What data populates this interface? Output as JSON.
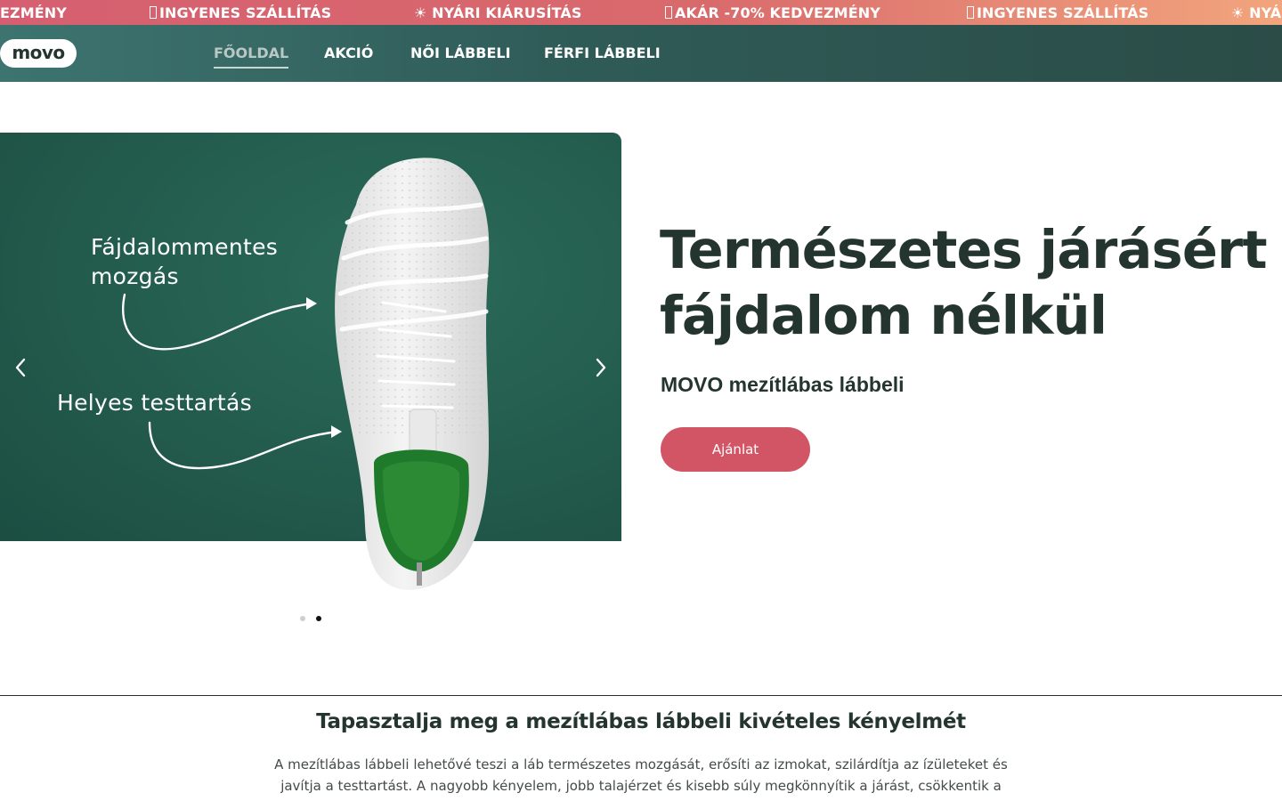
{
  "announcement_bar": {
    "items": [
      {
        "icon": "",
        "text": "EZMÉNY"
      },
      {
        "icon": "box-icon",
        "text": "INGYENES SZÁLLÍTÁS"
      },
      {
        "icon": "sun-icon",
        "text": "☀ NYÁRI KIÁRUSÍTÁS"
      },
      {
        "icon": "box-icon",
        "text": "AKÁR -70% KEDVEZMÉNY"
      },
      {
        "icon": "box-icon",
        "text": "INGYENES SZÁLLÍTÁS"
      },
      {
        "icon": "sun-icon",
        "text": "☀ NYÁ"
      }
    ]
  },
  "header": {
    "logo": "movo",
    "nav": [
      {
        "label": "FŐOLDAL",
        "active": true
      },
      {
        "label": "AKCIÓ",
        "active": false
      },
      {
        "label": "NŐI LÁBBELI",
        "active": false
      },
      {
        "label": "FÉRFI LÁBBELI",
        "active": false
      }
    ]
  },
  "hero": {
    "slide": {
      "callout_1": [
        "Fájdalommentes",
        "mozgás"
      ],
      "callout_2": "Helyes testtartás"
    },
    "title_lines": [
      "Természetes járásért",
      "fájdalom nélkül"
    ],
    "subtitle": "MOVO mezítlábas lábbeli",
    "cta": "Ajánlat",
    "dots": {
      "count": 2,
      "active_index": 1
    }
  },
  "section": {
    "title": "Tapasztalja meg a mezítlábas lábbeli kivételes kényelmét",
    "body_lines": [
      "A mezítlábas lábbeli lehetővé teszi a láb természetes mozgását, erősíti az izmokat, szilárdítja az ízületeket és",
      "javítja a testtartást. A nagyobb kényelem, jobb talajérzet és kisebb súly megkönnyítik a járást, csökkentik a"
    ]
  },
  "colors": {
    "brand_dark": "#24342f",
    "accent_red": "#d25566",
    "slide_green": "#245e4f",
    "header_teal": "#2f5b57"
  }
}
